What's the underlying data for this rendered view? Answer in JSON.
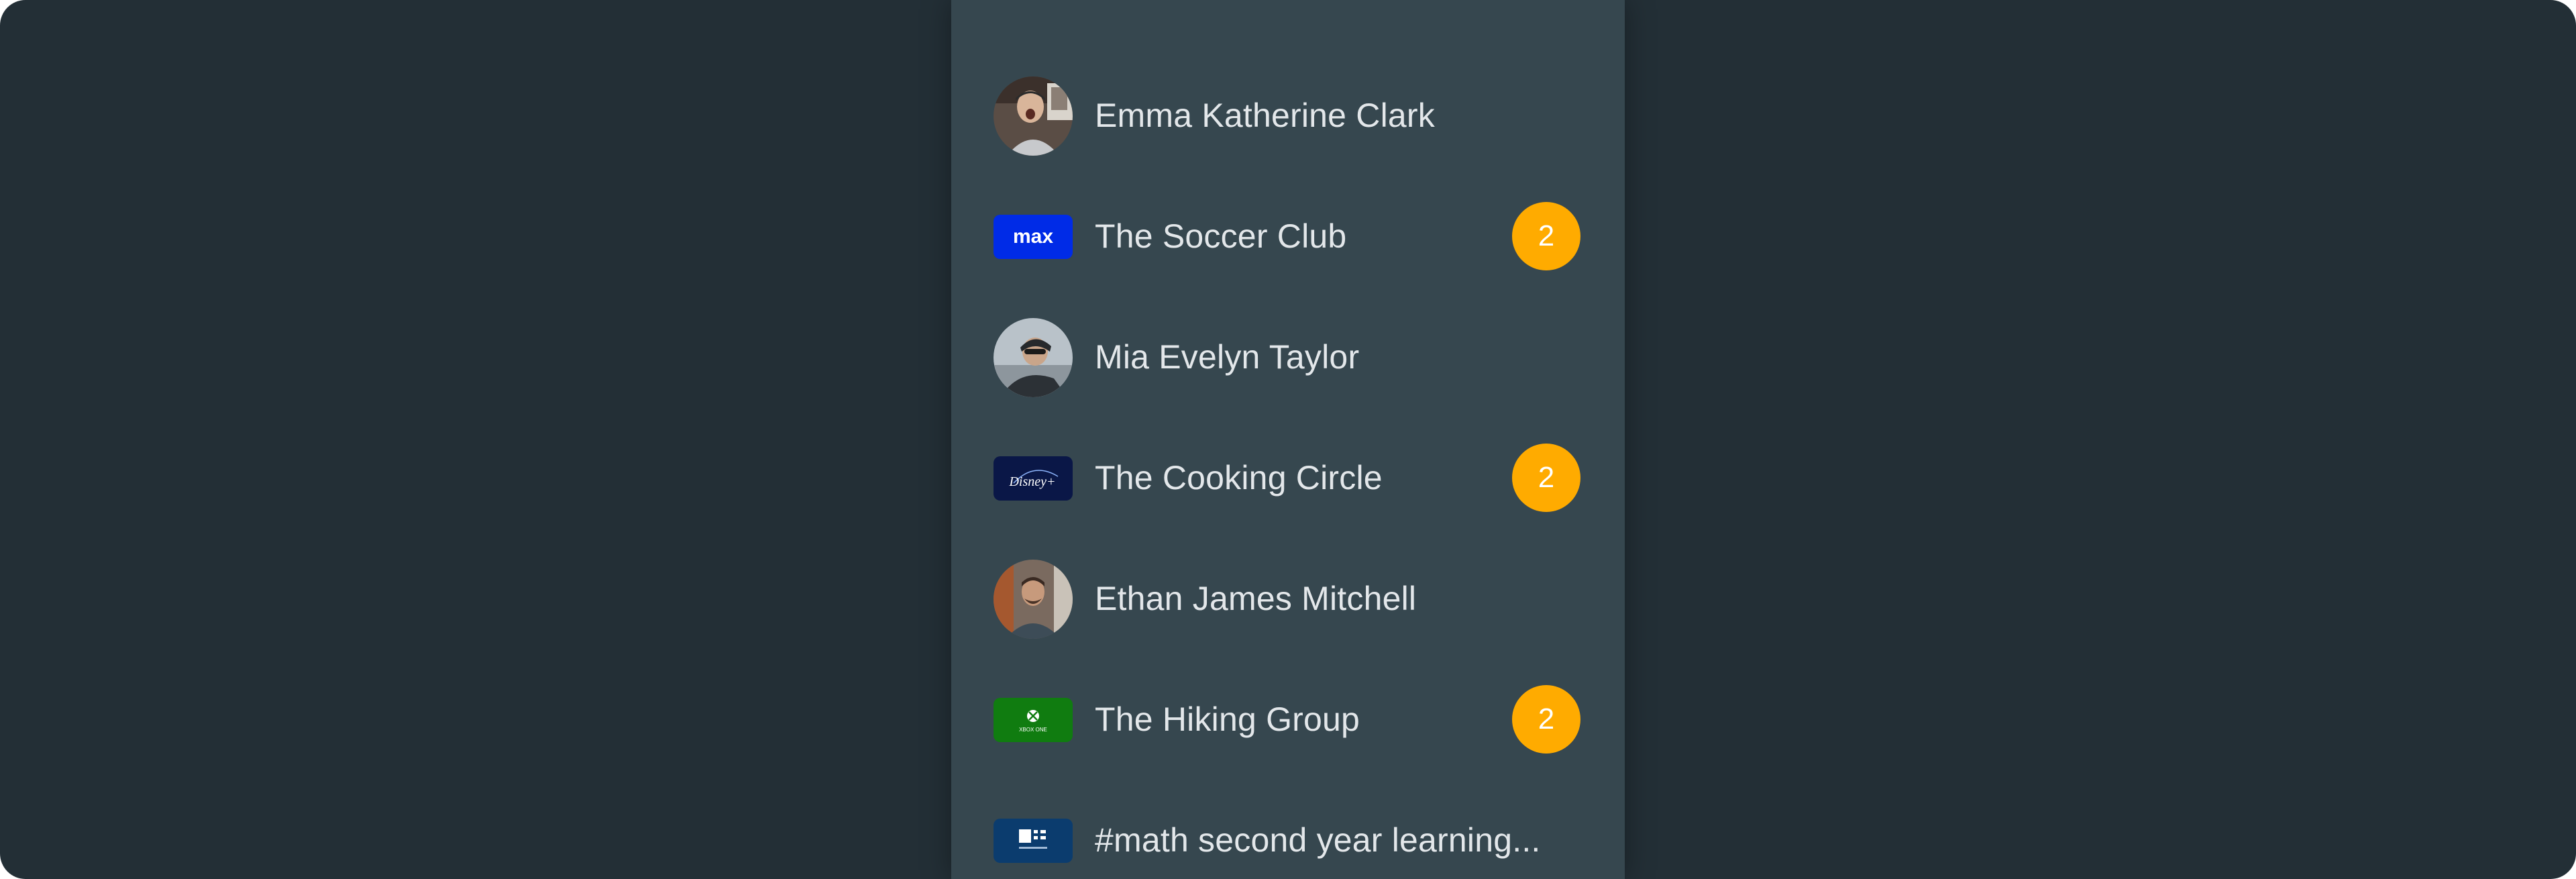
{
  "chat_list": {
    "items": [
      {
        "name": "Emma Katherine Clark",
        "type": "person",
        "badge": null
      },
      {
        "name": "The Soccer Club",
        "type": "group",
        "logo": "max-logo",
        "badge": "2"
      },
      {
        "name": "Mia Evelyn Taylor",
        "type": "person",
        "badge": null
      },
      {
        "name": "The Cooking Circle",
        "type": "group",
        "logo": "disney-plus-logo",
        "badge": "2"
      },
      {
        "name": "Ethan James Mitchell",
        "type": "person",
        "badge": null
      },
      {
        "name": "The Hiking Group",
        "type": "group",
        "logo": "xbox-logo",
        "badge": "2"
      },
      {
        "name": "#math second year learning...",
        "type": "channel",
        "logo": "news-logo",
        "badge": null
      }
    ]
  },
  "logos": {
    "max": "max",
    "disney": "Disney+",
    "xbox": "XBOX ONE"
  },
  "colors": {
    "background": "#232f36",
    "panel": "#36474f",
    "badge": "#ffab00",
    "text": "#e3e7ea",
    "max_logo": "#002be7",
    "disney_logo": "#0a1747",
    "xbox_logo": "#107c10",
    "news_logo": "#0b3c6e"
  }
}
